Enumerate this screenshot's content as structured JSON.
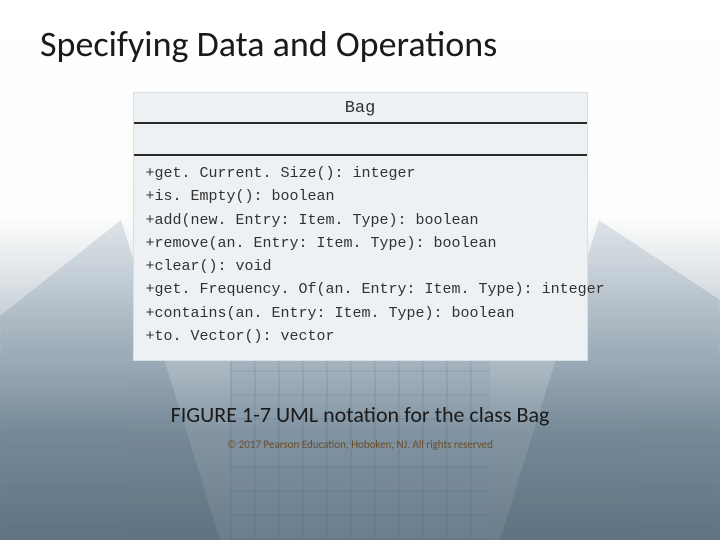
{
  "slide": {
    "title": "Specifying Data and Operations",
    "caption": "FIGURE 1-7 UML notation for the class Bag",
    "copyright": "© 2017 Pearson Education, Hoboken, NJ.  All rights reserved"
  },
  "uml": {
    "class_name": "Bag",
    "ops": [
      "+get. Current. Size(): integer",
      "+is. Empty(): boolean",
      "+add(new. Entry: Item. Type): boolean",
      "+remove(an. Entry: Item. Type): boolean",
      "+clear(): void",
      "+get. Frequency. Of(an. Entry: Item. Type): integer",
      "+contains(an. Entry: Item. Type): boolean",
      "+to. Vector(): vector"
    ]
  }
}
